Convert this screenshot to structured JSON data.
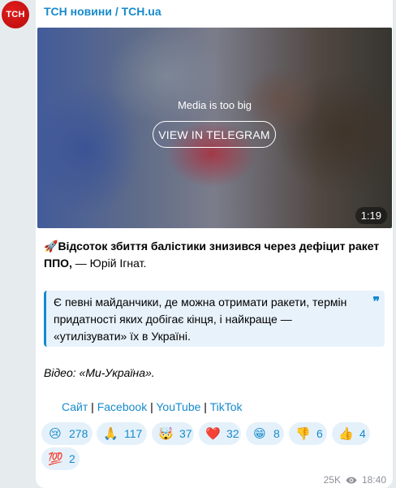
{
  "channel": {
    "avatar_text": "ТСН",
    "name": "ТСН новини / TCH.ua"
  },
  "media": {
    "notice": "Media is too big",
    "button_label": "VIEW IN TELEGRAM",
    "duration": "1:19"
  },
  "post": {
    "emoji": "🚀",
    "headline_bold": "Відсоток збиття балістики знизився через дефіцит ракет ППО,",
    "headline_rest": " — Юрій Ігнат.",
    "quote": "Є певні майданчики, де можна отримати ракети, термін придатності яких добігає кінця, і найкраще — «утилізувати» їх в Україні.",
    "credit": "Відео: «Ми-Україна».",
    "links": {
      "site": "Сайт",
      "facebook": "Facebook",
      "youtube": "YouTube",
      "tiktok": "TikTok",
      "separator": " | "
    }
  },
  "reactions": [
    {
      "emoji": "😢",
      "count": "278"
    },
    {
      "emoji": "🙏",
      "count": "117"
    },
    {
      "emoji": "🤯",
      "count": "37"
    },
    {
      "emoji": "❤️",
      "count": "32"
    },
    {
      "emoji": "😁",
      "count": "8"
    },
    {
      "emoji": "👎",
      "count": "6"
    },
    {
      "emoji": "👍",
      "count": "4"
    },
    {
      "emoji": "💯",
      "count": "2"
    }
  ],
  "meta": {
    "views": "25K",
    "time": "18:40"
  },
  "colors": {
    "accent": "#168acd",
    "reaction_bg": "#e5f1fa",
    "quote_bg": "#e8f2fb",
    "avatar": "#d61818"
  }
}
